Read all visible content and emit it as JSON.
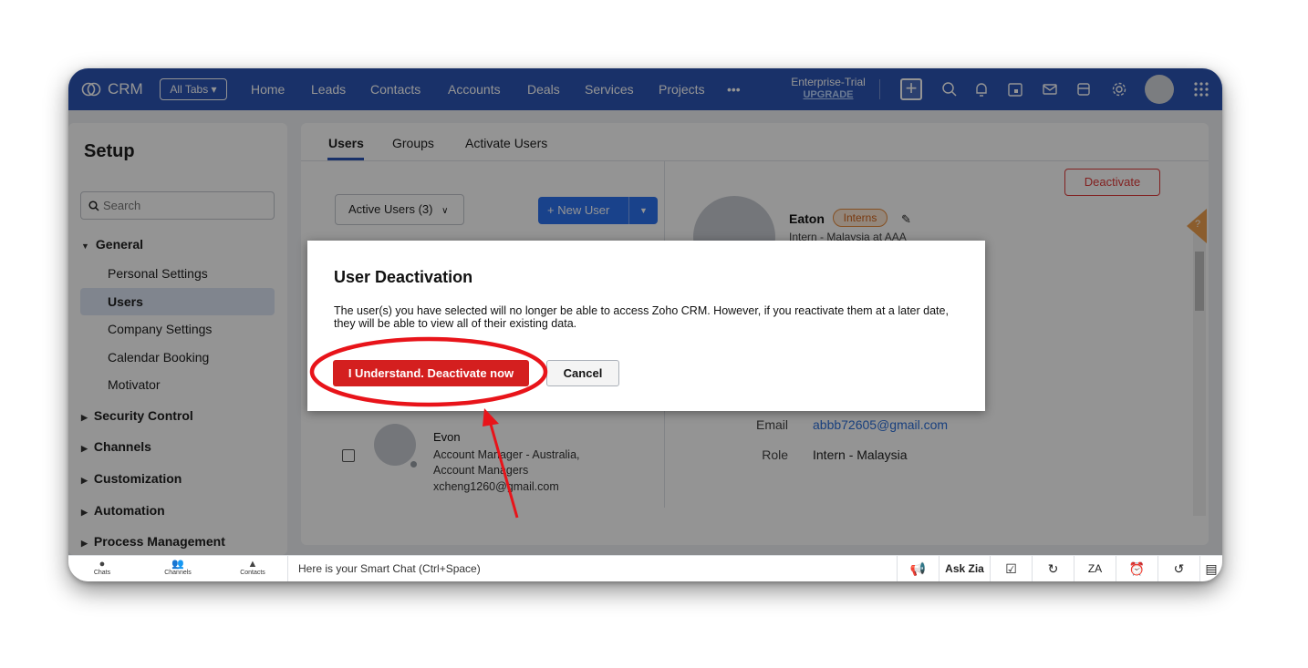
{
  "app": {
    "brand": "CRM",
    "all_tabs": "All Tabs ▾"
  },
  "nav": [
    "Home",
    "Leads",
    "Contacts",
    "Accounts",
    "Deals",
    "Services",
    "Projects",
    "•••"
  ],
  "trial": {
    "plan": "Enterprise-Trial",
    "upgrade": "UPGRADE"
  },
  "topbar_icons": [
    "plus-icon",
    "search-icon",
    "bell-icon",
    "calendar-icon",
    "mail-icon",
    "store-icon",
    "gear-icon",
    "avatar",
    "apps-grid-icon"
  ],
  "sidebar": {
    "heading": "Setup",
    "search_placeholder": "Search",
    "general": "General",
    "items": [
      "Personal Settings",
      "Users",
      "Company Settings",
      "Calendar Booking",
      "Motivator"
    ],
    "sections": [
      "Security Control",
      "Channels",
      "Customization",
      "Automation",
      "Process Management"
    ]
  },
  "main": {
    "tabs": [
      "Users",
      "Groups",
      "Activate Users"
    ],
    "active_users": "Active Users (3)",
    "new_user": "+ New User",
    "deactivate": "Deactivate",
    "profile": {
      "name": "Eaton",
      "badge": "Interns",
      "subtitle": "Intern - Malaysia at AAA"
    },
    "details": {
      "email_label": "Email",
      "email": "abbb72605@gmail.com",
      "role_label": "Role",
      "role": "Intern - Malaysia"
    },
    "list_user": {
      "name": "Evon",
      "line1": "Account Manager - Australia,",
      "line2": "Account Managers",
      "email": "xcheng1260@gmail.com"
    }
  },
  "modal": {
    "title": "User Deactivation",
    "message": "The user(s) you have selected will no longer be able to access Zoho CRM. However, if you reactivate them at a later date, they will be able to view all of their existing data.",
    "confirm": "I Understand. Deactivate now",
    "cancel": "Cancel"
  },
  "bottombar": {
    "chats": "Chats",
    "channels": "Channels",
    "contacts": "Contacts",
    "smart_chat": "Here is your Smart Chat (Ctrl+Space)",
    "ask_zia": "Ask Zia"
  },
  "colors": {
    "brand_blue": "#2b55b6",
    "danger_red": "#d41f1f",
    "annotation_red": "#e8141a"
  }
}
